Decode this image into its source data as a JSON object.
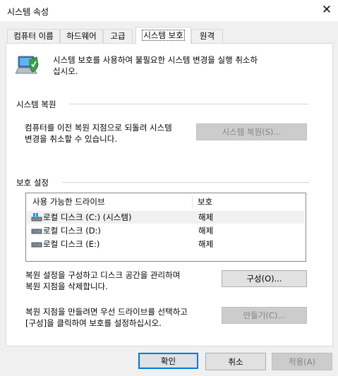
{
  "window": {
    "title": "시스템 속성",
    "close_glyph": "✕"
  },
  "tabs": [
    {
      "label": "컴퓨터 이름"
    },
    {
      "label": "하드웨어"
    },
    {
      "label": "고급"
    },
    {
      "label": "시스템 보호",
      "active": true
    },
    {
      "label": "원격"
    }
  ],
  "header": {
    "icon": "system-protection-icon",
    "line1": "시스템 보호를 사용하여 불필요한 시스템 변경을 실행 취소하",
    "line2": "십시오."
  },
  "restore": {
    "heading": "시스템 복원",
    "line1": "컴퓨터를 이전 복원 지점으로 되돌려 시스템",
    "line2": "변경을 취소할 수 있습니다.",
    "button": "시스템 복원(S)...",
    "button_enabled": false
  },
  "protection": {
    "heading": "보호 설정",
    "columns": [
      "사용 가능한 드라이브",
      "보호"
    ],
    "drives": [
      {
        "name": "로컬 디스크 (C:) (시스템)",
        "status": "해제",
        "icon": "system-drive-icon",
        "selected": true
      },
      {
        "name": "로컬 디스크 (D:)",
        "status": "해제",
        "icon": "drive-icon"
      },
      {
        "name": "로컬 디스크 (E:)",
        "status": "해제",
        "icon": "drive-icon"
      }
    ],
    "configure_line1": "복원 설정을 구성하고 디스크 공간을 관리하며",
    "configure_line2": "복원 지점을 삭제합니다.",
    "configure_button": "구성(O)...",
    "create_line1": "복원 지점을 만들려면 우선 드라이브를 선택하고",
    "create_line2": "[구성]을 클릭하여 보호를 설정하십시오.",
    "create_button": "만들기(C)...",
    "create_enabled": false
  },
  "footer": {
    "ok": "확인",
    "cancel": "취소",
    "apply": "적용(A)",
    "apply_enabled": false
  },
  "colors": {
    "accent": "#0078d7",
    "disabled_bg": "#cccccc",
    "disabled_text": "#838383"
  }
}
